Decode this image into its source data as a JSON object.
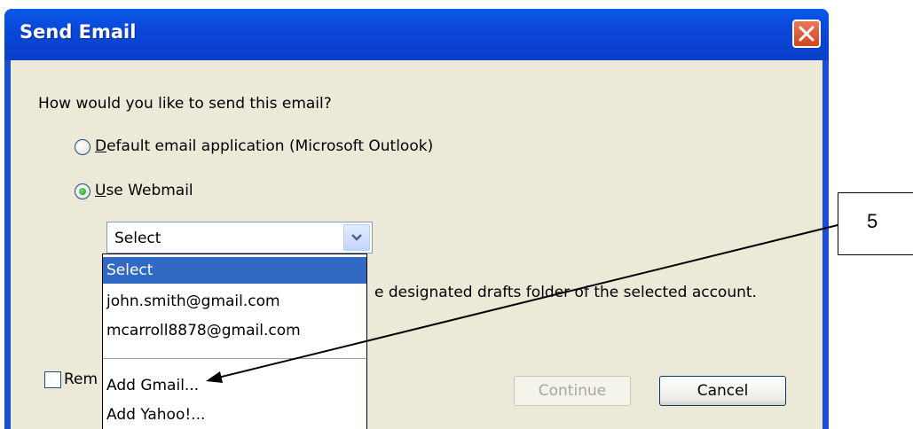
{
  "dialog": {
    "title": "Send Email",
    "prompt": "How would you like to send this email?",
    "options": [
      {
        "label": "Default email application (Microsoft Outlook)",
        "selected": false,
        "mnemonic": "D"
      },
      {
        "label": "Use Webmail",
        "selected": true,
        "mnemonic": "U"
      }
    ],
    "webmail_select": {
      "value": "Select"
    },
    "dropdown_items": [
      "Select",
      "john.smith@gmail.com",
      "mcarroll8878@gmail.com",
      "Add Gmail...",
      "Add Yahoo!..."
    ],
    "info_text_visible": "e designated drafts folder of the selected account.",
    "remember_label_visible": "Rem",
    "buttons": {
      "continue": "Continue",
      "cancel": "Cancel"
    }
  },
  "callout": {
    "number": "5"
  },
  "colors": {
    "titlebar": "#0a46d8",
    "selection": "#316ac5",
    "dialog_bg": "#ece9d8"
  }
}
